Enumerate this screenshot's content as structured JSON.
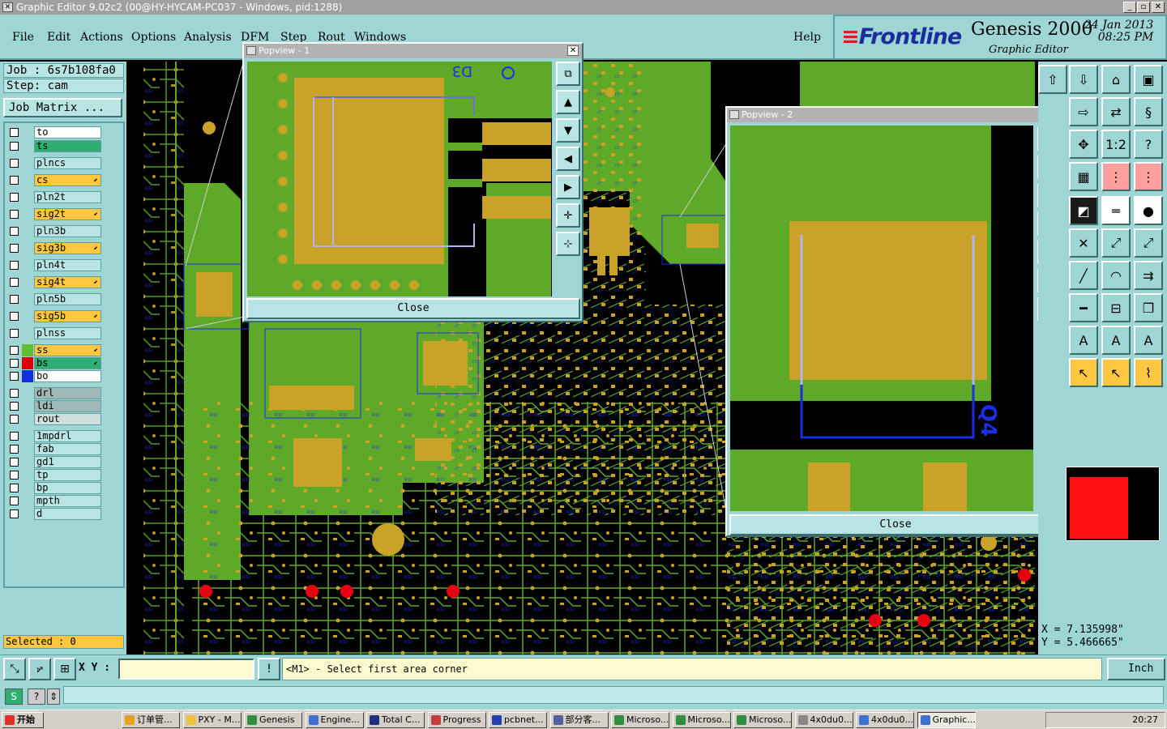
{
  "window": {
    "title": "Graphic Editor 9.02c2 (00@HY-HYCAM-PC037 - Windows, pid:1288)"
  },
  "menu": {
    "items": [
      "File",
      "Edit",
      "Actions",
      "Options",
      "Analysis",
      "DFM",
      "Step",
      "Rout",
      "Windows"
    ],
    "help": "Help"
  },
  "brand": {
    "logo": "Frontline",
    "product": "Genesis 2000",
    "subtitle": "Graphic Editor",
    "date": "24 Jan 2013",
    "time": "08:25 PM"
  },
  "job": {
    "job_text": "Job : 6s7b108fa0",
    "step_text": "Step: cam",
    "matrix_button": "Job Matrix ..."
  },
  "layers": [
    {
      "name": "to",
      "color": "#ffffff",
      "swatch": ""
    },
    {
      "name": "ts",
      "color": "#2fae73",
      "swatch": ""
    },
    {
      "name": "plncs",
      "color": "#b8e4e4",
      "swatch": ""
    },
    {
      "name": "cs",
      "color": "#ffc640",
      "swatch": "",
      "arrow": true
    },
    {
      "name": "pln2t",
      "color": "#b8e4e4",
      "swatch": ""
    },
    {
      "name": "sig2t",
      "color": "#ffc640",
      "swatch": "",
      "arrow": true
    },
    {
      "name": "pln3b",
      "color": "#b8e4e4",
      "swatch": ""
    },
    {
      "name": "sig3b",
      "color": "#ffc640",
      "swatch": "",
      "arrow": true
    },
    {
      "name": "pln4t",
      "color": "#b8e4e4",
      "swatch": ""
    },
    {
      "name": "sig4t",
      "color": "#ffc640",
      "swatch": "",
      "arrow": true
    },
    {
      "name": "pln5b",
      "color": "#b8e4e4",
      "swatch": ""
    },
    {
      "name": "sig5b",
      "color": "#ffc640",
      "swatch": "",
      "arrow": true
    },
    {
      "name": "plnss",
      "color": "#b8e4e4",
      "swatch": ""
    },
    {
      "name": "ss",
      "color": "#ffc640",
      "swatch": "#5fbf2f",
      "arrow": true
    },
    {
      "name": "bs",
      "color": "#2fae73",
      "swatch": "#e00000",
      "arrow": true
    },
    {
      "name": "bo",
      "color": "#ffffff",
      "swatch": "#1030e0"
    },
    {
      "name": "drl",
      "color": "#a0b8b8",
      "swatch": ""
    },
    {
      "name": "ldi",
      "color": "#a0b8b8",
      "swatch": ""
    },
    {
      "name": "rout",
      "color": "#d0dede",
      "swatch": ""
    },
    {
      "name": "1mpdrl",
      "color": "#b8e4e4",
      "swatch": ""
    },
    {
      "name": "fab",
      "color": "#b8e4e4",
      "swatch": ""
    },
    {
      "name": "gd1",
      "color": "#b8e4e4",
      "swatch": ""
    },
    {
      "name": "tp",
      "color": "#b8e4e4",
      "swatch": ""
    },
    {
      "name": "bp",
      "color": "#b8e4e4",
      "swatch": ""
    },
    {
      "name": "mpth",
      "color": "#b8e4e4",
      "swatch": ""
    },
    {
      "name": "d",
      "color": "#b8e4e4",
      "swatch": ""
    }
  ],
  "status": {
    "selected": "Selected : 0"
  },
  "coords": {
    "x": "X = 7.135998\"",
    "y": "Y = 5.466665\""
  },
  "popview1": {
    "title": "Popview - 1",
    "close": "Close",
    "refdes": "D3"
  },
  "popview2": {
    "title": "Popview - 2",
    "close": "Close",
    "refdes": "Q4"
  },
  "command": {
    "xy_label": "X Y :",
    "xy_value": "",
    "prompt": "<M1> - Select first area corner",
    "unit": "Inch"
  },
  "taskbar": {
    "start": "开始",
    "tasks": [
      "订单管...",
      "PXY - M...",
      "Genesis",
      "Engine...",
      "Total C...",
      "Progress",
      "pcbnet...",
      "部分客...",
      "Microso...",
      "Microso...",
      "Microso...",
      "4x0du0...",
      "4x0du0...",
      "Graphic..."
    ],
    "clock": "20:27"
  },
  "colors": {
    "board_green": "#5fa928",
    "copper": "#c9a227",
    "trace_blue": "#1a2ee6",
    "panel": "#9ed6d6",
    "pad_red": "#e50012"
  }
}
